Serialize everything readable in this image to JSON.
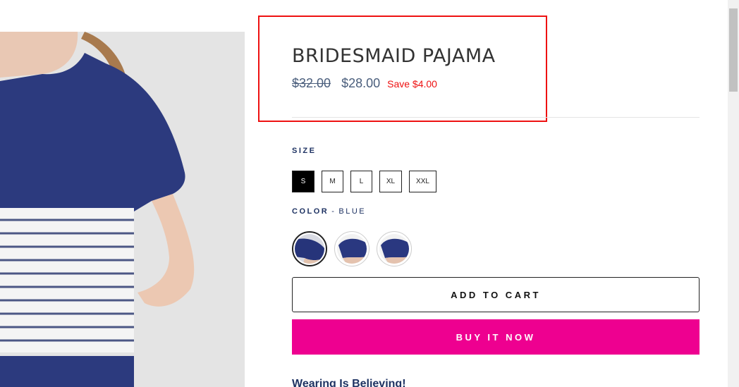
{
  "product": {
    "title": "BRIDESMAID PAJAMA",
    "compare_price": "$32.00",
    "sale_price": "$28.00",
    "save_text": "Save $4.00"
  },
  "size": {
    "label": "SIZE",
    "options": [
      "S",
      "M",
      "L",
      "XL",
      "XXL"
    ],
    "selected": "S"
  },
  "color": {
    "label": "COLOR",
    "separator": "-",
    "value": "BLUE",
    "swatches": [
      "blue-1",
      "blue-2",
      "blue-3"
    ]
  },
  "buttons": {
    "add_to_cart": "ADD TO CART",
    "buy_now": "BUY IT NOW"
  },
  "section": {
    "heading": "Wearing Is Believing!"
  },
  "colors": {
    "accent": "#ee0090",
    "navy": "#1f3363",
    "price": "#4a5e7c",
    "save": "#ee1111",
    "highlight": "#ee1111"
  }
}
